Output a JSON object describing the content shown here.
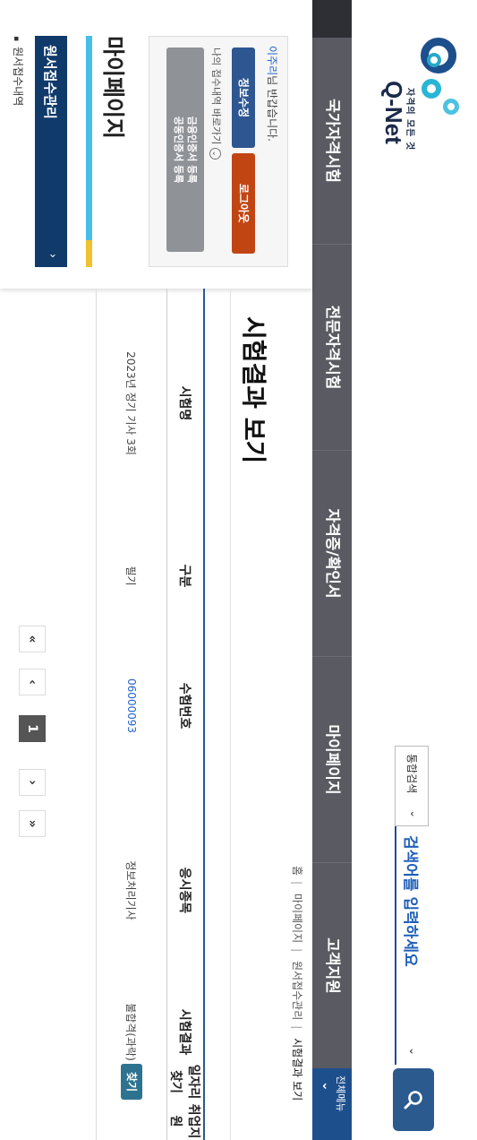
{
  "header": {
    "logo_tagline": "자격의 모든 것",
    "logo_name": "Q-Net",
    "search_scope": "통합검색",
    "search_placeholder": "검색어를 입력하세요"
  },
  "gnb": {
    "items": [
      "국가자격시험",
      "전문자격시험",
      "자격증/확인서",
      "마이페이지",
      "고객지원"
    ],
    "all_menu": "전체메뉴"
  },
  "user_box": {
    "name": "이주리",
    "greeting_suffix": "님 반갑습니다.",
    "edit_label": "정보수정",
    "logout_label": "로그아웃",
    "shortcut_label": "나의 접수내역 바로가기",
    "cert_line1": "금융인증서 등록",
    "cert_line2": "공동인증서 등록"
  },
  "sidebar": {
    "title": "마이페이지",
    "active_menu": "원서접수관리",
    "sub_item": "원서접수내역"
  },
  "breadcrumb": [
    "홈",
    "마이페이지",
    "원서접수관리",
    "시험결과 보기"
  ],
  "page": {
    "title": "시험결과 보기"
  },
  "table": {
    "headers": [
      "시험명",
      "구분",
      "수험번호",
      "응시종목",
      "시험결과",
      "일자리찾기",
      "취업지원"
    ],
    "rows": [
      {
        "exam": "2023년 정기 기사 3회",
        "type": "필기",
        "number": "06000093",
        "subject": "정보처리기사",
        "result": "불합격(과락)",
        "job_label": "찾기",
        "support": ""
      }
    ]
  },
  "pager": {
    "first": "«",
    "prev": "‹",
    "current": "1",
    "next": "›",
    "last": "»"
  }
}
